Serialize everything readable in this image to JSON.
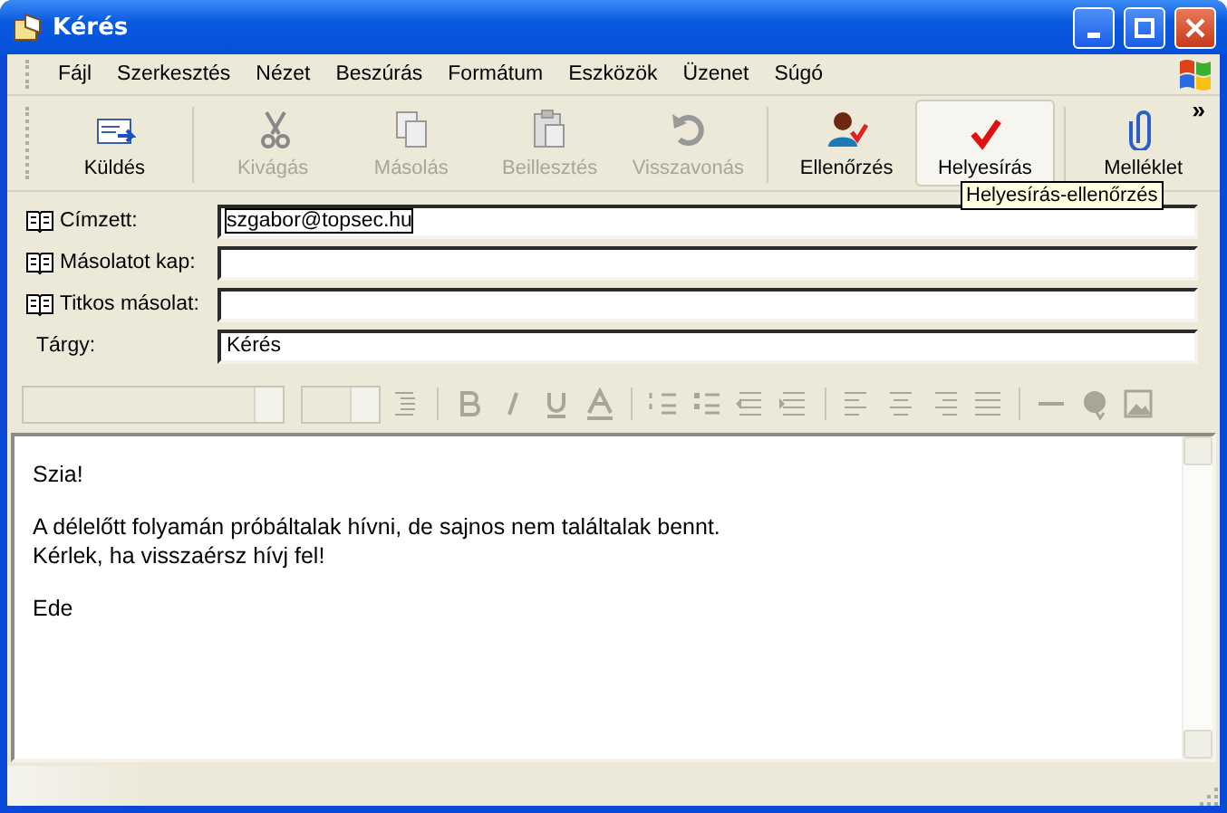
{
  "window": {
    "title": "Kérés"
  },
  "menu": [
    "Fájl",
    "Szerkesztés",
    "Nézet",
    "Beszúrás",
    "Formátum",
    "Eszközök",
    "Üzenet",
    "Súgó"
  ],
  "toolbar": [
    {
      "kind": "send",
      "label": "Küldés",
      "disabled": false,
      "hovered": false
    },
    {
      "kind": "cut",
      "label": "Kivágás",
      "disabled": true,
      "hovered": false
    },
    {
      "kind": "copy",
      "label": "Másolás",
      "disabled": true,
      "hovered": false
    },
    {
      "kind": "paste",
      "label": "Beillesztés",
      "disabled": true,
      "hovered": false
    },
    {
      "kind": "undo",
      "label": "Visszavonás",
      "disabled": true,
      "hovered": false
    },
    {
      "kind": "check-names",
      "label": "Ellenőrzés",
      "disabled": false,
      "hovered": false
    },
    {
      "kind": "spelling",
      "label": "Helyesírás",
      "disabled": false,
      "hovered": true
    },
    {
      "kind": "attach",
      "label": "Melléklet",
      "disabled": false,
      "hovered": false
    }
  ],
  "toolbar_chevron": "»",
  "tooltip": "Helyesírás-ellenőrzés",
  "fields": [
    {
      "kind": "address",
      "label": "Címzett:",
      "value": "szgabor@topsec.hu",
      "focused": true
    },
    {
      "kind": "address",
      "label": "Másolatot kap:",
      "focused": false
    },
    {
      "kind": "address",
      "label": "Titkos másolat:",
      "focused": false
    },
    {
      "kind": "plain",
      "label": "Tárgy:",
      "value": "Kérés",
      "focused": false
    }
  ],
  "body": [
    [
      "Szia!"
    ],
    [
      "A délelőtt folyamán próbáltalak hívni, de sajnos nem találtalak bennt.",
      "Kérlek, ha visszaérsz hívj fel!"
    ],
    [
      "Ede"
    ]
  ]
}
